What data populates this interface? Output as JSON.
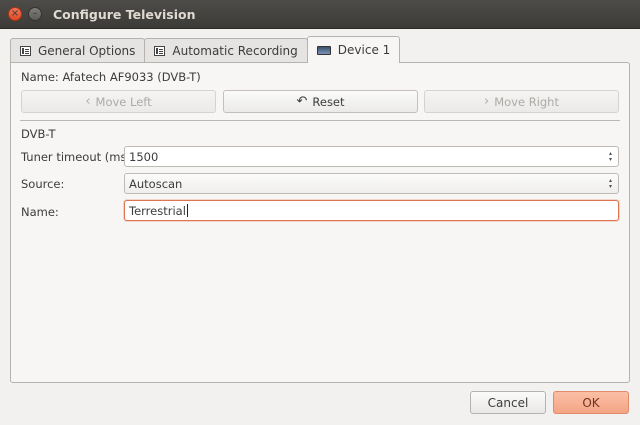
{
  "window": {
    "title": "Configure Television",
    "close_glyph": "×",
    "minimize_glyph": "–"
  },
  "tabs": [
    {
      "label": "General Options",
      "icon": "list-icon",
      "active": false
    },
    {
      "label": "Automatic Recording",
      "icon": "list-icon",
      "active": false
    },
    {
      "label": "Device 1",
      "icon": "tv-icon",
      "active": true
    }
  ],
  "device": {
    "name_line": "Name: Afatech AF9033 (DVB-T)",
    "move_left": {
      "glyph": "‹",
      "label": "Move Left",
      "enabled": false
    },
    "reset": {
      "glyph": "↶",
      "label": "Reset",
      "enabled": true
    },
    "move_right": {
      "glyph": "›",
      "label": "Move Right",
      "enabled": false
    }
  },
  "group": {
    "label": "DVB-T"
  },
  "form": {
    "tuner_timeout": {
      "label": "Tuner timeout (ms):",
      "value": "1500"
    },
    "source": {
      "label": "Source:",
      "value": "Autoscan"
    },
    "name": {
      "label": "Name:",
      "value": "Terrestrial"
    },
    "spin_up": "▴",
    "spin_down": "▾"
  },
  "footer": {
    "cancel": "Cancel",
    "ok": "OK"
  },
  "colors": {
    "focus_accent": "#e0744f",
    "ok_button": "#f4a584",
    "close_button": "#de4b25"
  }
}
